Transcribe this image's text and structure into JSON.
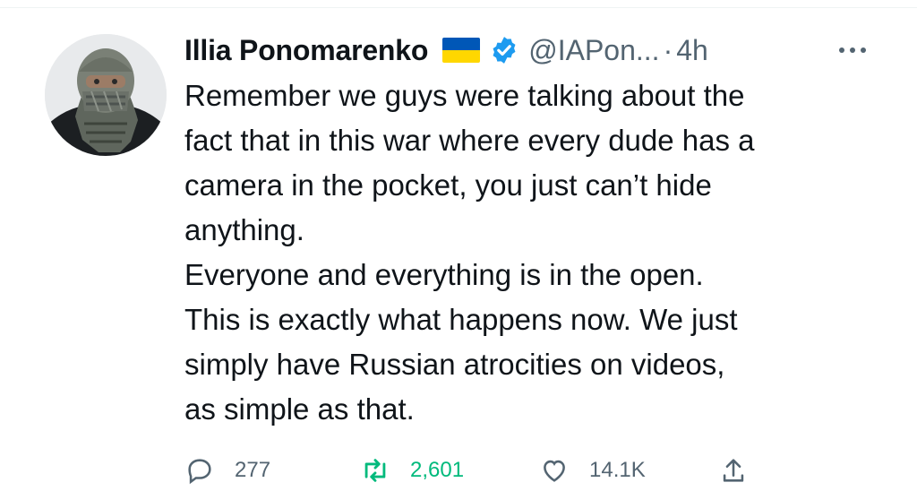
{
  "tweet": {
    "author_name": "Illia Ponomarenko",
    "handle": "@IAPon...",
    "separator": "·",
    "time": "4h",
    "text_lines": [
      "Remember we guys were talking about the",
      "fact that in this war where every dude has a",
      "camera in the pocket, you just can’t hide",
      "anything.",
      "Everyone and everything is in the open.",
      "This is exactly what happens now. We just",
      "simply have Russian atrocities on videos,",
      "as simple as that."
    ],
    "actions": {
      "reply_count": "277",
      "retweet_count": "2,601",
      "like_count": "14.1K"
    }
  },
  "icons": {
    "flag": "ukraine-flag-icon",
    "verified": "verified-badge-icon",
    "more": "more-options-icon",
    "reply": "reply-icon",
    "retweet": "retweet-icon",
    "like": "heart-icon",
    "share": "share-icon"
  },
  "colors": {
    "text": "#0f1419",
    "secondary": "#536471",
    "verified": "#1d9bf0",
    "retweet_active": "#00ba7c",
    "flag_blue": "#0057b7",
    "flag_yellow": "#ffd700"
  }
}
